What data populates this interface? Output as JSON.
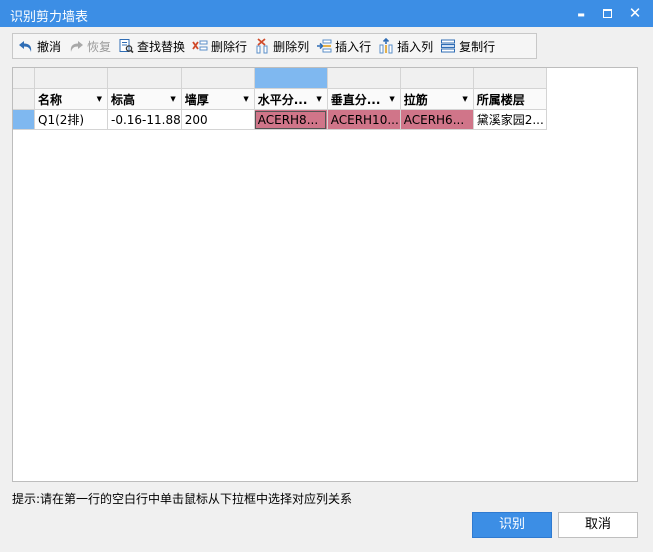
{
  "window": {
    "title": "识别剪力墙表",
    "min_glyph": "▬",
    "close_glyph": "✕"
  },
  "toolbar": {
    "undo": "撤消",
    "redo": "恢复",
    "find_replace": "查找替换",
    "delete_row": "删除行",
    "delete_col": "删除列",
    "insert_row": "插入行",
    "insert_col": "插入列",
    "copy_row": "复制行"
  },
  "grid": {
    "headers": [
      "名称",
      "标高",
      "墙厚",
      "水平分...",
      "垂直分...",
      "拉筋",
      "所属楼层"
    ],
    "dropdown_glyph": "▼",
    "row": [
      "Q1(2排)",
      "-0.16-11.88",
      "200",
      "ACERH8...",
      "ACERH10...",
      "ACERH6...",
      "黛溪家园2..."
    ]
  },
  "hint": "提示:请在第一行的空白行中单击鼠标从下拉框中选择对应列关系",
  "buttons": {
    "ok": "识别",
    "cancel": "取消"
  },
  "colors": {
    "accent": "#3c8ee5",
    "selection": "#7fb8f0",
    "pink_cell": "#d07589"
  }
}
